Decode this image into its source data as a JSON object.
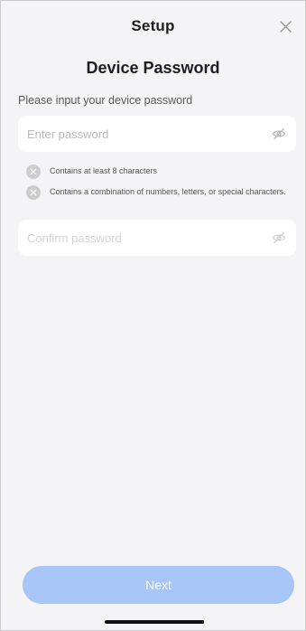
{
  "header": {
    "title": "Setup",
    "close_icon": "close-icon"
  },
  "page": {
    "title": "Device Password",
    "instruction": "Please input your device password"
  },
  "password_field": {
    "placeholder": "Enter password",
    "value": "",
    "toggle_icon": "eye-slash-icon"
  },
  "rules": [
    {
      "text": "Contains at least 8 characters",
      "icon": "x-circle-icon"
    },
    {
      "text": "Contains a combination of numbers, letters, or special characters.",
      "icon": "x-circle-icon"
    }
  ],
  "confirm_field": {
    "placeholder": "Confirm password",
    "value": "",
    "toggle_icon": "eye-slash-icon"
  },
  "next_button": {
    "label": "Next"
  },
  "colors": {
    "background": "#f4f4f6",
    "button": "#a7c6f7",
    "button_text": "#ffffff",
    "rule_icon": "#cccccc"
  }
}
